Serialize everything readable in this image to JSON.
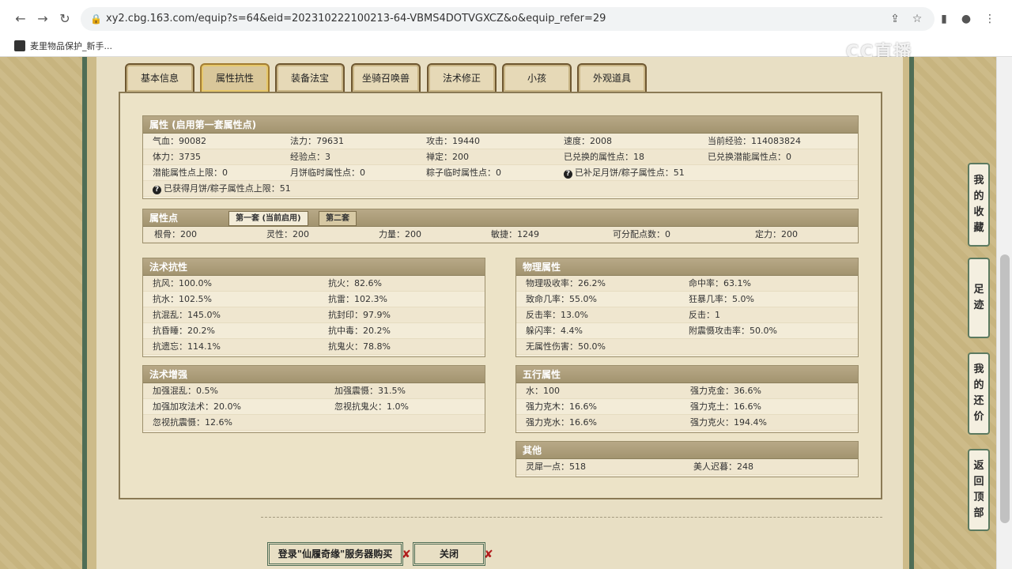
{
  "browser": {
    "url": "xy2.cbg.163.com/equip?s=64&eid=202310222100213-64-VBMS4DOTVGXCZ&o&equip_refer=29",
    "bookmark": "麦里物品保护_新手...",
    "watermark": "CC直播"
  },
  "tabs": [
    "基本信息",
    "属性抗性",
    "装备法宝",
    "坐骑召唤兽",
    "法术修正",
    "小孩",
    "外观道具"
  ],
  "active_tab": "属性抗性",
  "attributes": {
    "title": "属性 (启用第一套属性点)",
    "rows": [
      [
        "气血：90082",
        "法力：79631",
        "攻击：19440",
        "速度：2008",
        "当前经验：114083824"
      ],
      [
        "体力：3735",
        "经验点：3",
        "禅定：200",
        "已兑换的属性点：18",
        "已兑换潜能属性点：0"
      ],
      [
        "潜能属性点上限：0",
        "月饼临时属性点：0",
        "粽子临时属性点：0",
        "已补足月饼/粽子属性点：51"
      ],
      [
        "已获得月饼/粽子属性点上限：51"
      ]
    ]
  },
  "points": {
    "title": "属性点",
    "subtabs": [
      "第一套 (当前启用)",
      "第二套"
    ],
    "row": [
      "根骨：200",
      "灵性：200",
      "力量：200",
      "敏捷：1249",
      "可分配点数：0",
      "定力：200"
    ]
  },
  "magic_resist": {
    "title": "法术抗性",
    "rows": [
      [
        "抗风：100.0%",
        "抗火：82.6%"
      ],
      [
        "抗水：102.5%",
        "抗雷：102.3%"
      ],
      [
        "抗混乱：145.0%",
        "抗封印：97.9%"
      ],
      [
        "抗昏睡：20.2%",
        "抗中毒：20.2%"
      ],
      [
        "抗遗忘：114.1%",
        "抗鬼火：78.8%"
      ]
    ]
  },
  "magic_boost": {
    "title": "法术增强",
    "rows": [
      [
        "加强混乱：0.5%",
        "加强震慑：31.5%"
      ],
      [
        "加强加攻法术：20.0%",
        "忽视抗鬼火：1.0%"
      ],
      [
        "忽视抗震慑：12.6%",
        ""
      ]
    ]
  },
  "physical": {
    "title": "物理属性",
    "rows": [
      [
        "物理吸收率：26.2%",
        "命中率：63.1%"
      ],
      [
        "致命几率：55.0%",
        "狂暴几率：5.0%"
      ],
      [
        "反击率：13.0%",
        "反击：1"
      ],
      [
        "躲闪率：4.4%",
        "附震慑攻击率：50.0%"
      ],
      [
        "无属性伤害：50.0%",
        ""
      ]
    ]
  },
  "five_elements": {
    "title": "五行属性",
    "rows": [
      [
        "水：100",
        "强力克金：36.6%"
      ],
      [
        "强力克木：16.6%",
        "强力克土：16.6%"
      ],
      [
        "强力克水：16.6%",
        "强力克火：194.4%"
      ]
    ]
  },
  "other": {
    "title": "其他",
    "rows": [
      [
        "灵犀一点：518",
        "美人迟暮：248"
      ]
    ]
  },
  "side_buttons": [
    [
      "我",
      "的",
      "收",
      "藏"
    ],
    [
      "足",
      "迹"
    ],
    [
      "我",
      "的",
      "还",
      "价"
    ],
    [
      "返",
      "回",
      "顶",
      "部"
    ]
  ],
  "bottom_buttons": {
    "login": "登录\"仙履奇缘\"服务器购买",
    "close": "关闭"
  },
  "colors": {
    "frame_green": "#4f6d55",
    "panel_header": "#a2946f",
    "close_x": "#b01d1d"
  }
}
